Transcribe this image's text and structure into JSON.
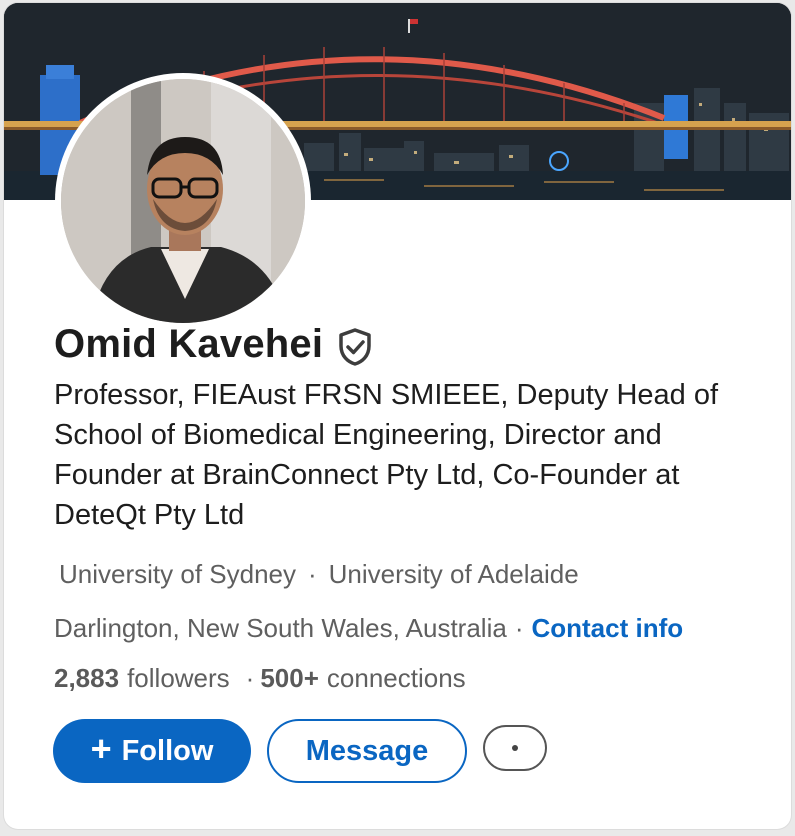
{
  "profile": {
    "name": "Omid Kavehei",
    "verified_icon": "shield-check-icon",
    "headline": "Professor, FIEAust FRSN SMIEEE, Deputy Head of School of Biomedical Engineering, Director and Founder at BrainConnect Pty Ltd, Co-Founder at DeteQt Pty Ltd",
    "education": [
      "University of Sydney",
      "University of Adelaide"
    ],
    "location": "Darlington, New South Wales, Australia",
    "contact_label": "Contact info",
    "followers_count": "2,883",
    "followers_label": "followers",
    "connections_count": "500+",
    "connections_label": "connections",
    "separator": "·"
  },
  "actions": {
    "follow_label": "Follow",
    "follow_icon": "plus-icon",
    "message_label": "Message",
    "more_icon": "ellipsis-icon"
  },
  "colors": {
    "accent": "#0a66c2",
    "text_primary": "#1d1d1d",
    "text_secondary": "#5f5f5f"
  }
}
